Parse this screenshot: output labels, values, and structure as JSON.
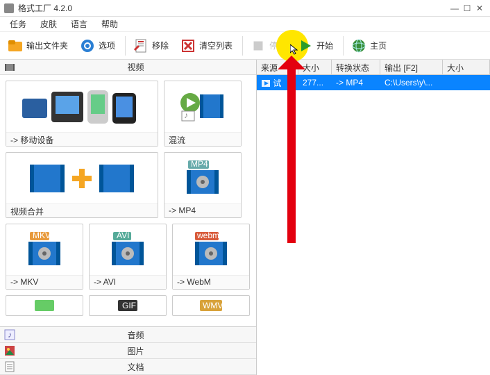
{
  "window": {
    "title": "格式工厂 4.2.0",
    "min": "—",
    "max": "☐",
    "close": "✕"
  },
  "menu": {
    "task": "任务",
    "skin": "皮肤",
    "lang": "语言",
    "help": "帮助"
  },
  "toolbar": {
    "output_folder": "输出文件夹",
    "options": "选项",
    "remove": "移除",
    "clear_list": "清空列表",
    "stop": "停止",
    "start": "开始",
    "home": "主页"
  },
  "categories": {
    "video": "视频",
    "audio": "音频",
    "picture": "图片",
    "document": "文档"
  },
  "tiles": {
    "mobile": "-> 移动设备",
    "mux": "混流",
    "merge": "视频合并",
    "mp4": "-> MP4",
    "mkv": "-> MKV",
    "avi": "-> AVI",
    "webm": "-> WebM",
    "mkv_badge": "MKV",
    "avi_badge": "AVI",
    "webm_badge": "webm",
    "mp4_badge": "MP4",
    "gif_badge": "GIF",
    "wmv_badge": "WMV"
  },
  "table": {
    "headers": {
      "source": "来源",
      "size": "大小",
      "status": "转换状态",
      "output": "输出 [F2]",
      "outsize": "大小"
    },
    "row": {
      "source": "试",
      "size": "277...",
      "status": "-> MP4",
      "output": "C:\\Users\\y\\...",
      "outsize": ""
    }
  }
}
